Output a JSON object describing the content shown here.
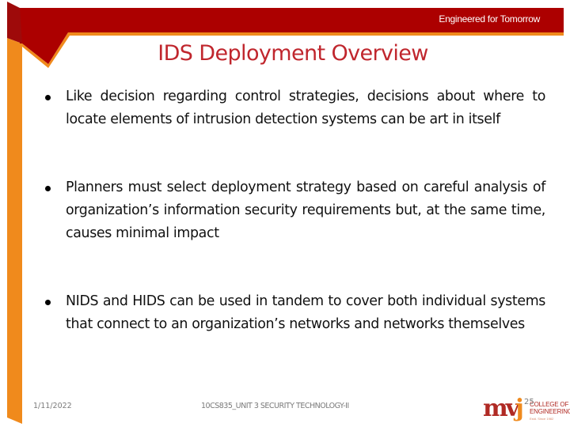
{
  "header": {
    "tagline": "Engineered for Tomorrow"
  },
  "slide": {
    "title": "IDS Deployment Overview",
    "bullets": [
      "Like decision regarding control strategies, decisions about where to locate elements of intrusion detection systems can be art in itself",
      "Planners must select deployment strategy based on careful analysis of organization’s information security requirements but, at the same time, causes minimal impact",
      "NIDS and HIDS can be used in tandem to cover both individual systems that connect to an organization’s networks and networks themselves"
    ]
  },
  "footer": {
    "date": "1/11/2022",
    "course": "10CS835_UNIT 3 SECURITY TECHNOLOGY-II",
    "page_number": "25"
  },
  "logo": {
    "mark_mv": "mv",
    "mark_j": "j",
    "line1": "COLLEGE OF",
    "line2": "ENGINEERING",
    "sub": "Estd. Since 1982"
  },
  "colors": {
    "band_red": "#ac0000",
    "flag_red": "#9e0a0a",
    "accent_orange": "#f08a1c",
    "title_red": "#c0262d"
  }
}
